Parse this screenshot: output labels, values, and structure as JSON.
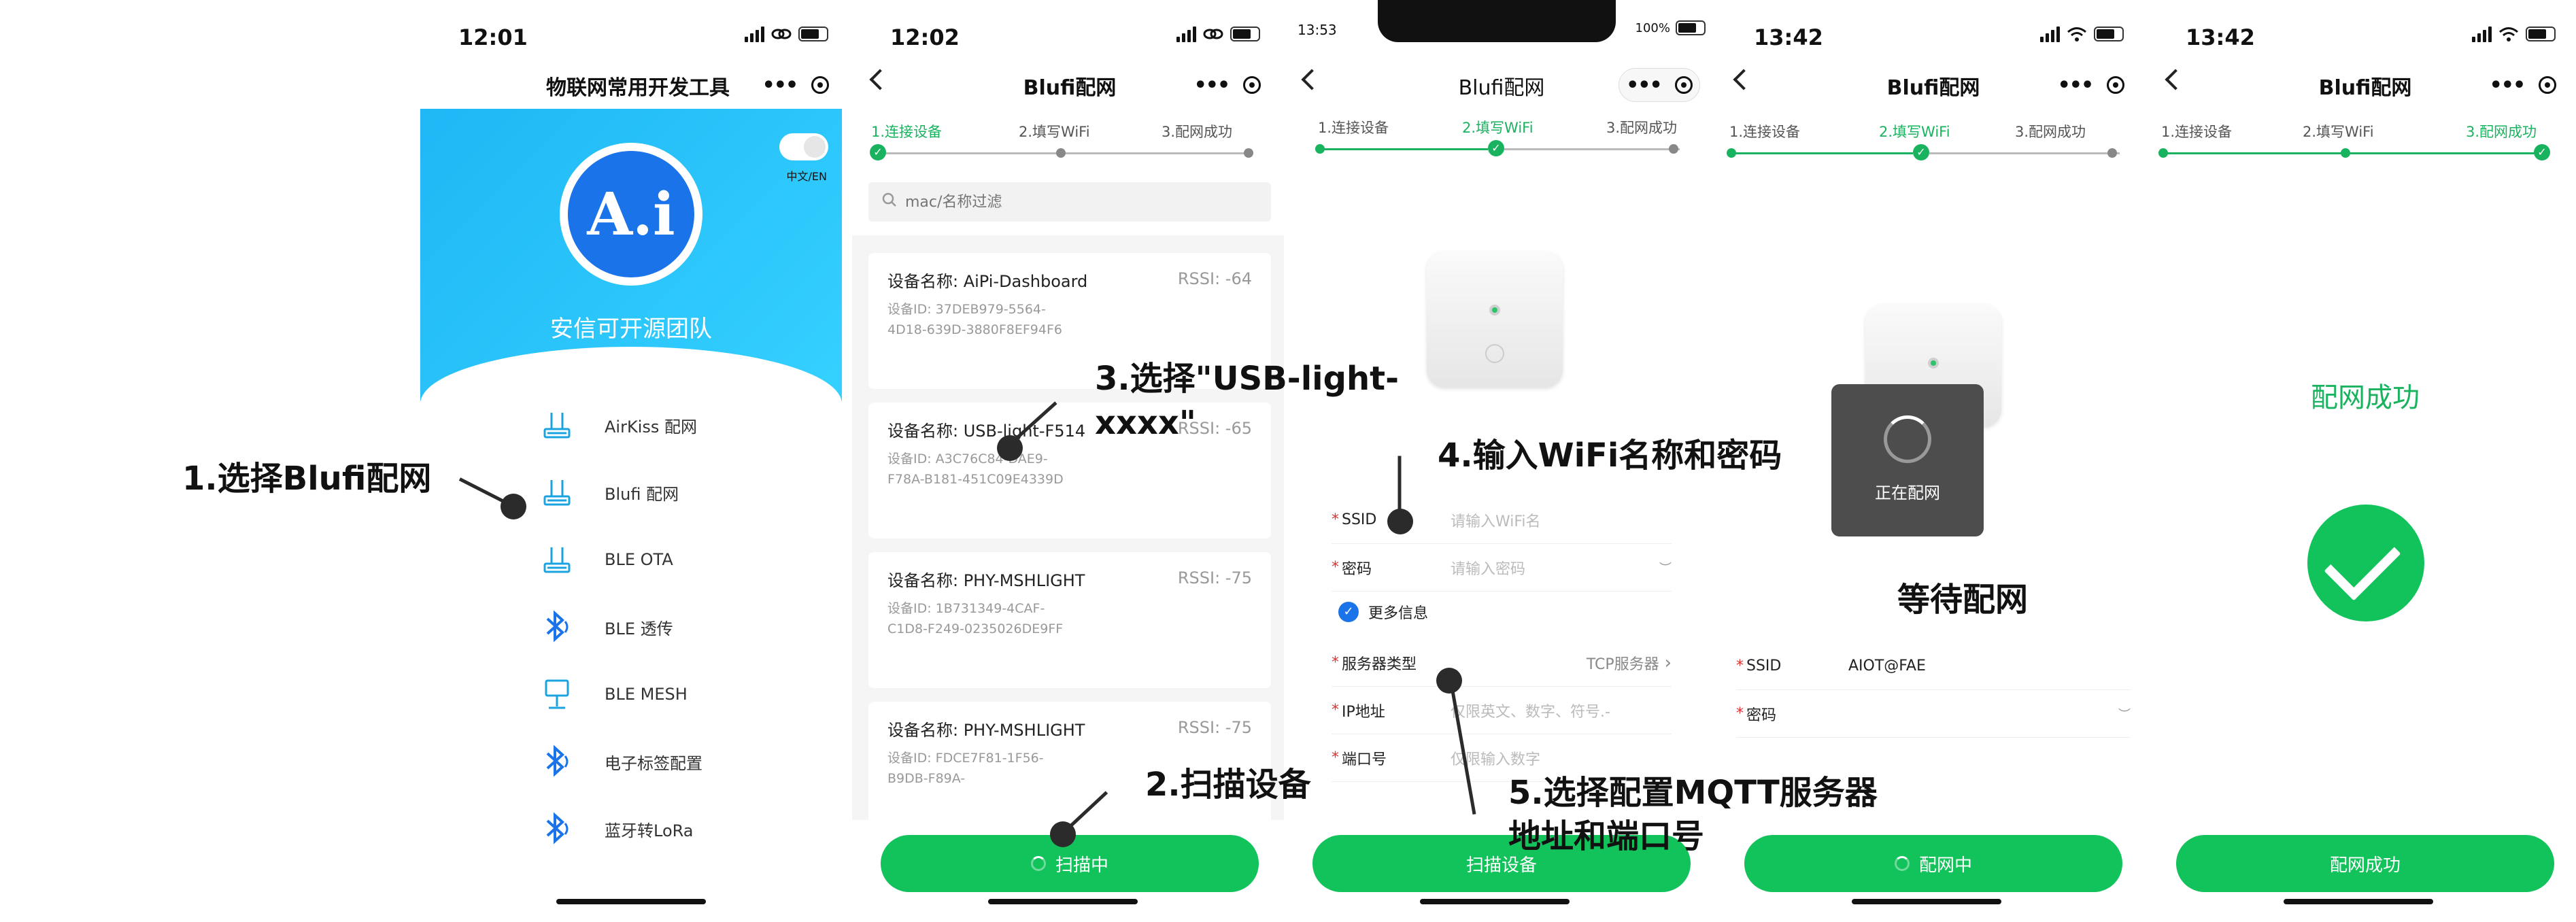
{
  "screens": {
    "s1": {
      "time": "12:01",
      "title": "物联网常用开发工具",
      "team": "安信可开源团队",
      "logo_text": "A.i",
      "lang_toggle": "中文/EN",
      "menu": [
        {
          "label": "AirKiss 配网",
          "icon": "router-icon"
        },
        {
          "label": "Blufi 配网",
          "icon": "router-icon"
        },
        {
          "label": "BLE OTA",
          "icon": "router-icon"
        },
        {
          "label": "BLE 透传",
          "icon": "bluetooth-icon"
        },
        {
          "label": "BLE MESH",
          "icon": "lamp-icon"
        },
        {
          "label": "电子标签配置",
          "icon": "bluetooth-icon"
        },
        {
          "label": "蓝牙转LoRa",
          "icon": "bluetooth-icon"
        }
      ]
    },
    "s2": {
      "time": "12:02",
      "title": "Blufi配网",
      "steps": [
        "1.连接设备",
        "2.填写WiFi",
        "3.配网成功"
      ],
      "search_placeholder": "mac/名称过滤",
      "devices": [
        {
          "name": "设备名称: AiPi-Dashboard",
          "rssi": "RSSI: -64",
          "id": "设备ID: 37DEB979-5564-4D18-639D-3880F8EF94F6"
        },
        {
          "name": "设备名称: USB-light-F514",
          "rssi": "RSSI: -65",
          "id": "设备ID: A3C76C84-DAE9-F78A-B181-451C09E4339D"
        },
        {
          "name": "设备名称: PHY-MSHLIGHT",
          "rssi": "RSSI: -75",
          "id": "设备ID: 1B731349-4CAF-C1D8-F249-0235026DE9FF"
        },
        {
          "name": "设备名称: PHY-MSHLIGHT",
          "rssi": "RSSI: -75",
          "id": "设备ID: FDCE7F81-1F56-B9DB-F89A-"
        }
      ],
      "button": "扫描中"
    },
    "s3": {
      "time": "13:53",
      "battery": "100%",
      "title": "Blufi配网",
      "steps": [
        "1.连接设备",
        "2.填写WiFi",
        "3.配网成功"
      ],
      "fields": {
        "ssid_label": "SSID",
        "ssid_placeholder": "请输入WiFi名",
        "pwd_label": "密码",
        "pwd_placeholder": "请输入密码",
        "more": "更多信息",
        "server_label": "服务器类型",
        "server_value": "TCP服务器",
        "ip_label": "IP地址",
        "ip_placeholder": "仅限英文、数字、符号.-",
        "port_label": "端口号",
        "port_placeholder": "仅限输入数字"
      },
      "button": "扫描设备"
    },
    "s4": {
      "time": "13:42",
      "title": "Blufi配网",
      "steps": [
        "1.连接设备",
        "2.填写WiFi",
        "3.配网成功"
      ],
      "toast": "正在配网",
      "ssid_label": "SSID",
      "ssid_value": "AIOT@FAE",
      "pwd_label": "密码",
      "button": "配网中"
    },
    "s5": {
      "time": "13:42",
      "title": "Blufi配网",
      "steps": [
        "1.连接设备",
        "2.填写WiFi",
        "3.配网成功"
      ],
      "success": "配网成功",
      "button": "配网成功"
    }
  },
  "annotations": {
    "a1": "1.选择Blufi配网",
    "a2": "2.扫描设备",
    "a3_line1": "3.选择\"USB-light-",
    "a3_line2": "xxxx\"",
    "a4": "4.输入WiFi名称和密码",
    "a5_line1": "5.选择配置MQTT服务器",
    "a5_line2": "地址和端口号",
    "a6": "等待配网"
  },
  "colors": {
    "primary_green": "#12c25a",
    "step_green": "#19b35f",
    "hero_blue": "#1fb7f5",
    "icon_blue": "#1a73e8"
  }
}
